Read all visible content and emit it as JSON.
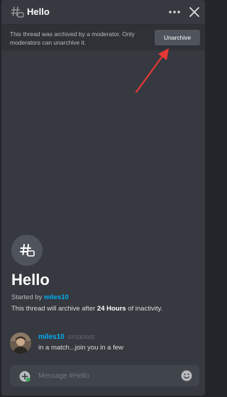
{
  "header": {
    "title": "Hello",
    "thread_icon": "thread-hash-icon",
    "more_icon": "more-dots-icon",
    "close_icon": "close-icon"
  },
  "banner": {
    "text": "This thread was archived by a moderator. Only moderators can unarchive it.",
    "button_label": "Unarchive"
  },
  "thread_start": {
    "title": "Hello",
    "started_by_prefix": "Started by ",
    "started_by_author": "miles10",
    "archive_prefix": "This thread will archive after ",
    "archive_duration": "24 Hours",
    "archive_suffix": " of inactivity."
  },
  "message": {
    "author": "miles10",
    "timestamp": "07/13/2022",
    "text": "in a match...join you in a few"
  },
  "composer": {
    "placeholder": "Message #Hello"
  },
  "colors": {
    "background": "#36393f",
    "banner": "#2f3136",
    "accent_link": "#00aff4",
    "annotation_arrow": "#e53935"
  }
}
